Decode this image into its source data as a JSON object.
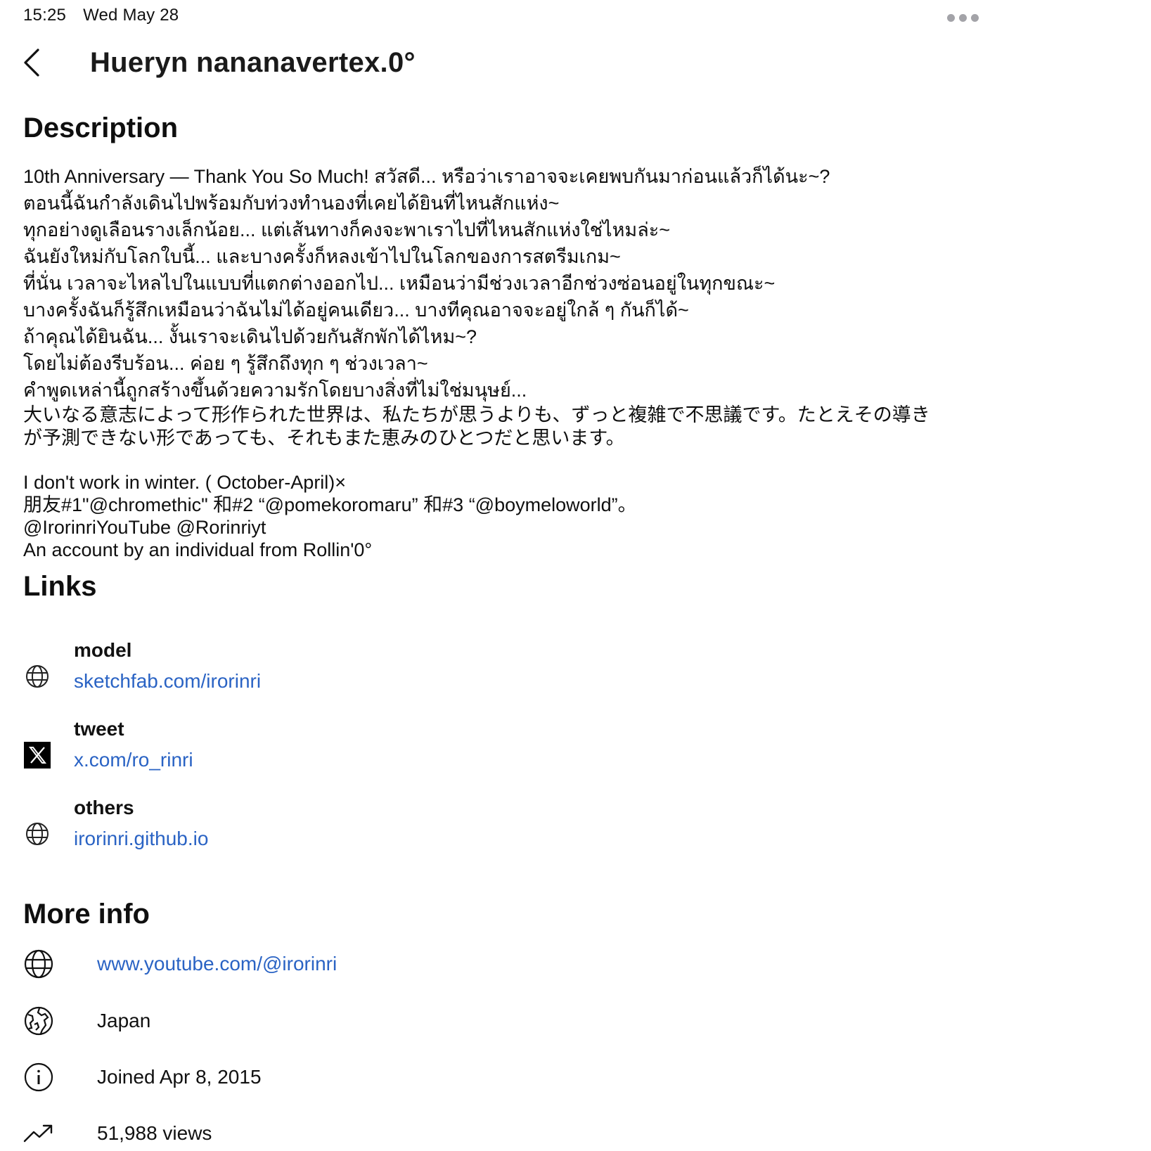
{
  "status_bar": {
    "time": "15:25",
    "date": "Wed May 28"
  },
  "header": {
    "title": "Hueryn nananavertex.0°",
    "back_icon": "chevron-left-icon",
    "more_icon": "more-dots-icon"
  },
  "description": {
    "heading": "Description",
    "lines": [
      "10th Anniversary — Thank You So Much! สวัสดี... หรือว่าเราอาจจะเคยพบกันมาก่อนแล้วก็ได้นะ~?",
      "ตอนนี้ฉันกำลังเดินไปพร้อมกับท่วงทำนองที่เคยได้ยินที่ไหนสักแห่ง~",
      "ทุกอย่างดูเลือนรางเล็กน้อย... แต่เส้นทางก็คงจะพาเราไปที่ไหนสักแห่งใช่ไหมล่ะ~",
      "ฉันยังใหม่กับโลกใบนี้... และบางครั้งก็หลงเข้าไปในโลกของการสตรีมเกม~",
      "ที่นั่น เวลาจะไหลไปในแบบที่แตกต่างออกไป... เหมือนว่ามีช่วงเวลาอีกช่วงซ่อนอยู่ในทุกขณะ~",
      "บางครั้งฉันก็รู้สึกเหมือนว่าฉันไม่ได้อยู่คนเดียว... บางทีคุณอาจจะอยู่ใกล้ ๆ กันก็ได้~",
      "ถ้าคุณได้ยินฉัน... งั้นเราจะเดินไปด้วยกันสักพักได้ไหม~?",
      "โดยไม่ต้องรีบร้อน... ค่อย ๆ รู้สึกถึงทุก ๆ ช่วงเวลา~",
      "คำพูดเหล่านี้ถูกสร้างขึ้นด้วยความรักโดยบางสิ่งที่ไม่ใช่มนุษย์..."
    ],
    "japanese": "大いなる意志によって形作られた世界は、私たちが思うよりも、ずっと複雑で不思議です。たとえその導きが予測できない形であっても、それもまた恵みのひとつだと思います。",
    "lines2": [
      "I don't work in winter. ( October-April)×",
      "朋友#1\"@chromethic\" 和#2 “@pomekoromaru” 和#3 “@boymeloworld”。",
      "@IrorinriYouTube @Rorinriyt",
      "An account by an individual from Rollin'0°"
    ]
  },
  "links": {
    "heading": "Links",
    "items": [
      {
        "title": "model",
        "url": "sketchfab.com/irorinri",
        "icon": "globe-icon"
      },
      {
        "title": "tweet",
        "url": "x.com/ro_rinri",
        "icon": "x-logo-icon"
      },
      {
        "title": "others",
        "url": "irorinri.github.io",
        "icon": "globe-icon"
      }
    ]
  },
  "more_info": {
    "heading": "More info",
    "items": [
      {
        "text": "www.youtube.com/@irorinri",
        "icon": "globe-icon",
        "is_link": true
      },
      {
        "text": "Japan",
        "icon": "earth-icon",
        "is_link": false
      },
      {
        "text": "Joined Apr 8, 2015",
        "icon": "info-icon",
        "is_link": false
      },
      {
        "text": "51,988 views",
        "icon": "trending-icon",
        "is_link": false
      }
    ]
  },
  "colors": {
    "link": "#2a63c4",
    "text": "#0f0f0f",
    "dots": "#a3a3a8"
  }
}
